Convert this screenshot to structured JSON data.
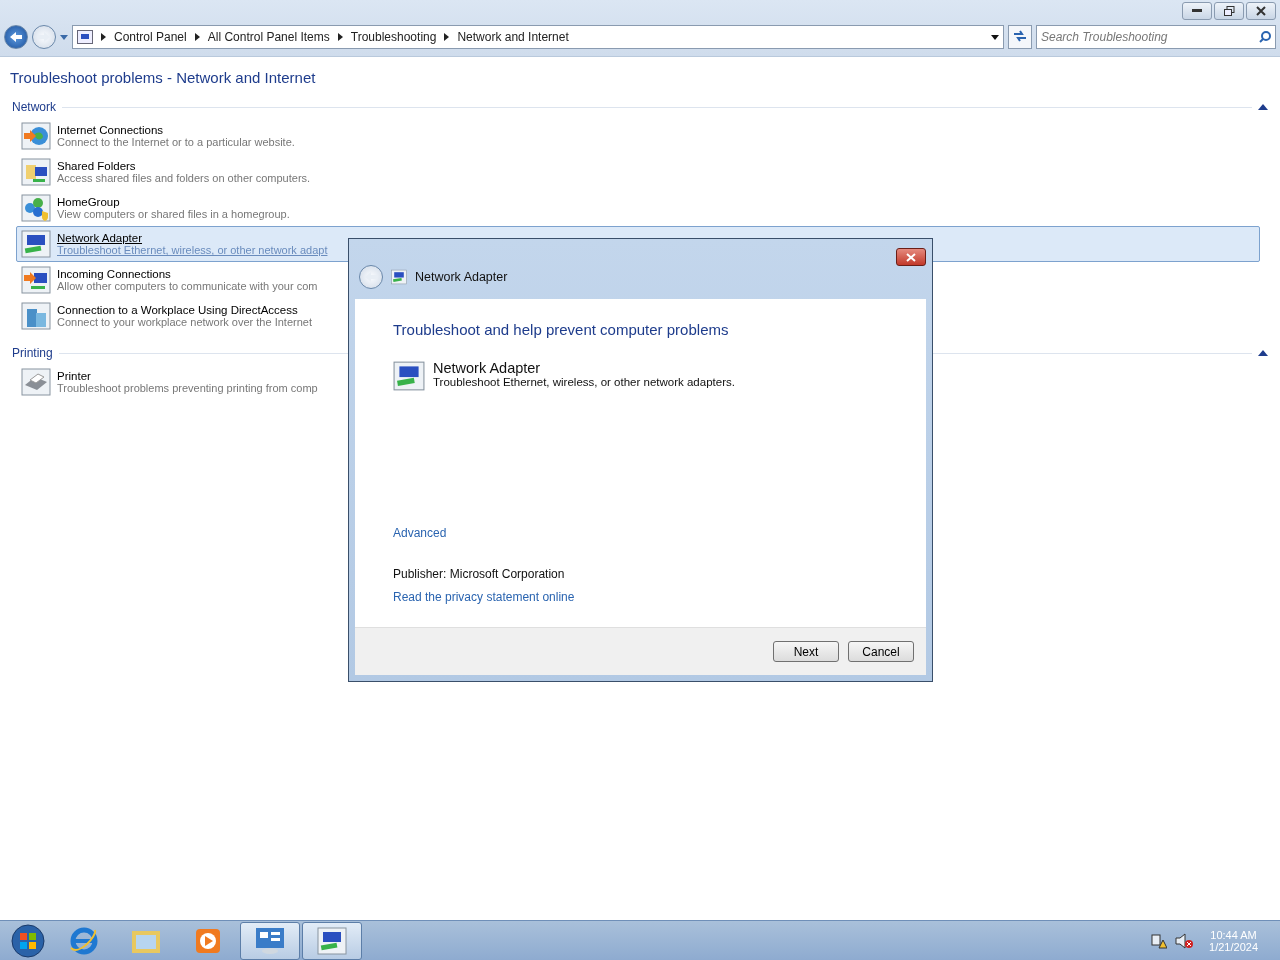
{
  "address_bar": {
    "crumbs": [
      "Control Panel",
      "All Control Panel Items",
      "Troubleshooting",
      "Network and Internet"
    ]
  },
  "search": {
    "placeholder": "Search Troubleshooting"
  },
  "page_title": "Troubleshoot problems - Network and Internet",
  "sections": [
    {
      "title": "Network",
      "expanded": true,
      "items": [
        {
          "name": "Internet Connections",
          "description": "Connect to the Internet or to a particular website.",
          "selected": false
        },
        {
          "name": "Shared Folders",
          "description": "Access shared files and folders on other computers.",
          "selected": false
        },
        {
          "name": "HomeGroup",
          "description": "View computers or shared files in a homegroup.",
          "selected": false
        },
        {
          "name": "Network Adapter",
          "description": "Troubleshoot Ethernet, wireless, or other network adapt",
          "selected": true
        },
        {
          "name": "Incoming Connections",
          "description": "Allow other computers to communicate with your com",
          "selected": false
        },
        {
          "name": "Connection to a Workplace Using DirectAccess",
          "description": "Connect to your workplace network over the Internet",
          "selected": false
        }
      ]
    },
    {
      "title": "Printing",
      "expanded": true,
      "items": [
        {
          "name": "Printer",
          "description": "Troubleshoot problems preventing printing from comp",
          "selected": false
        }
      ]
    }
  ],
  "dialog": {
    "title": "Network Adapter",
    "heading": "Troubleshoot and help prevent computer problems",
    "troubleshooter": {
      "name": "Network Adapter",
      "description": "Troubleshoot Ethernet, wireless, or other network adapters."
    },
    "advanced_link": "Advanced",
    "publisher_label": "Publisher:",
    "publisher": "Microsoft Corporation",
    "privacy_link": "Read the privacy statement online",
    "buttons": [
      "Next",
      "Cancel"
    ]
  },
  "taskbar": {
    "apps": [
      {
        "selected": false
      },
      {
        "selected": false
      },
      {
        "selected": false
      },
      {
        "selected": true
      },
      {
        "selected": true
      }
    ],
    "time": "10:44 AM",
    "date": "1/21/2024"
  }
}
